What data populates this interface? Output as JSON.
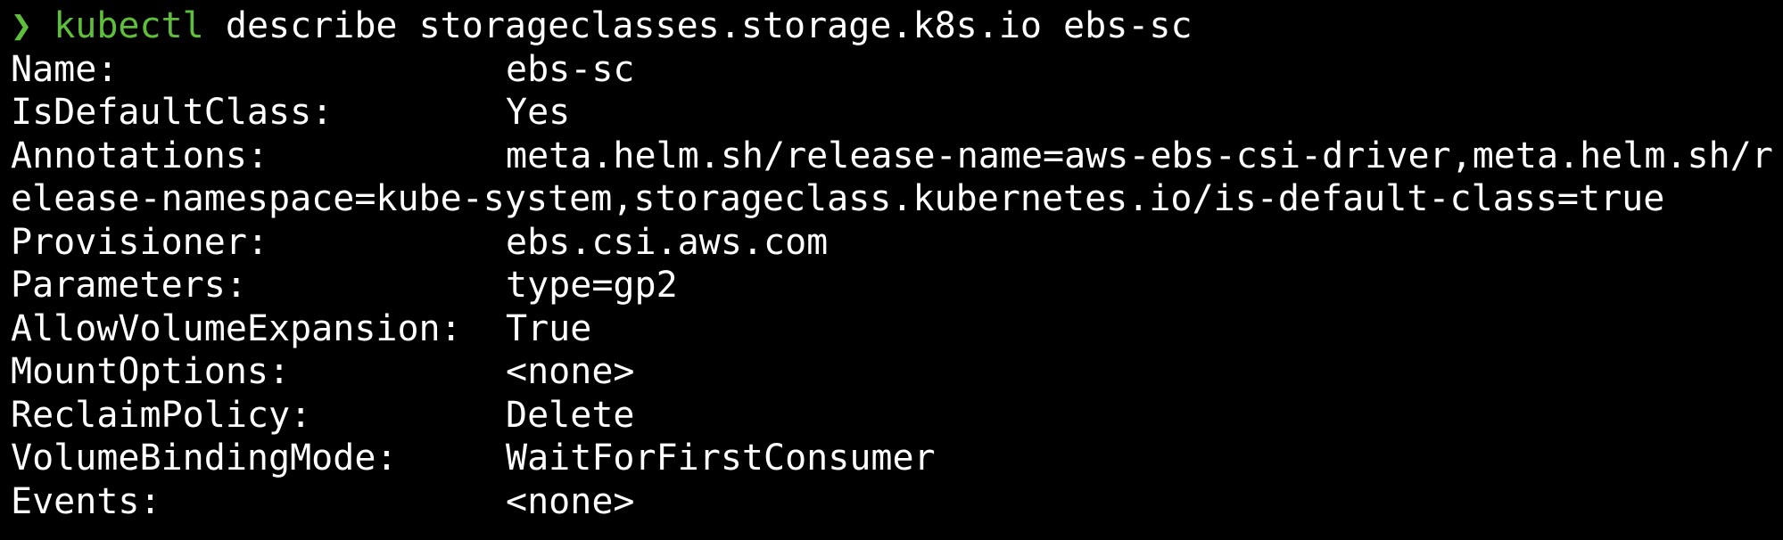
{
  "terminal": {
    "prompt": "❯",
    "command_bin": "kubectl",
    "command_args": "describe storageclasses.storage.k8s.io ebs-sc",
    "colors": {
      "background": "#000000",
      "text": "#ffffff",
      "prompt_accent": "#5fbf3a"
    },
    "fields": [
      {
        "label": "Name:",
        "value": "ebs-sc"
      },
      {
        "label": "IsDefaultClass:",
        "value": "Yes"
      },
      {
        "label": "Annotations:",
        "value": "meta.helm.sh/release-name=aws-ebs-csi-driver,meta.helm.sh/r"
      },
      {
        "label": "",
        "value": "elease-namespace=kube-system,storageclass.kubernetes.io/is-default-class=true"
      },
      {
        "label": "Provisioner:",
        "value": "ebs.csi.aws.com"
      },
      {
        "label": "Parameters:",
        "value": "type=gp2"
      },
      {
        "label": "AllowVolumeExpansion:",
        "value": "True"
      },
      {
        "label": "MountOptions:",
        "value": "<none>"
      },
      {
        "label": "ReclaimPolicy:",
        "value": "Delete"
      },
      {
        "label": "VolumeBindingMode:",
        "value": "WaitForFirstConsumer"
      },
      {
        "label": "Events:",
        "value": "<none>"
      }
    ]
  }
}
